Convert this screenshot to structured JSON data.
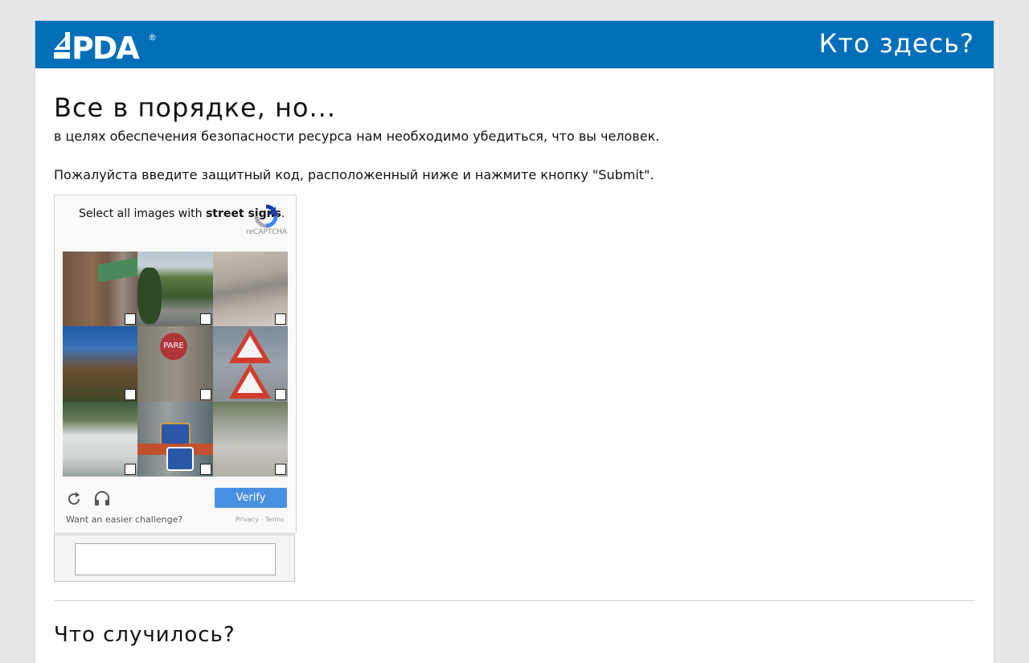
{
  "header": {
    "logo_text": "4PDA",
    "title": "Кто здесь?",
    "color": "#006fba"
  },
  "main": {
    "title": "Все в порядке, но...",
    "intro": "в целях обеспечения безопасности ресурса нам необходимо убедиться, что вы человек.",
    "instruction": "Пожалуйста введите защитный код, расположенный ниже и нажмите кнопку \"Submit\"."
  },
  "captcha": {
    "prompt_prefix": "Select all images with ",
    "prompt_bold": "street signs",
    "prompt_suffix": ".",
    "brand": "reCAPTCHA",
    "tiles": [
      "tile-1",
      "tile-2",
      "tile-3",
      "tile-4",
      "tile-5",
      "tile-6",
      "tile-7",
      "tile-8",
      "tile-9"
    ],
    "verify_label": "Verify",
    "verify_color": "#4a90e2",
    "easier_label": "Want an easier challenge?",
    "privacy_label": "Privacy",
    "separator": " - ",
    "terms_label": "Terms",
    "icons": [
      "refresh-icon",
      "headphones-icon"
    ]
  },
  "code_input": {
    "value": "",
    "placeholder": ""
  },
  "section2": {
    "title": "Что случилось?"
  }
}
